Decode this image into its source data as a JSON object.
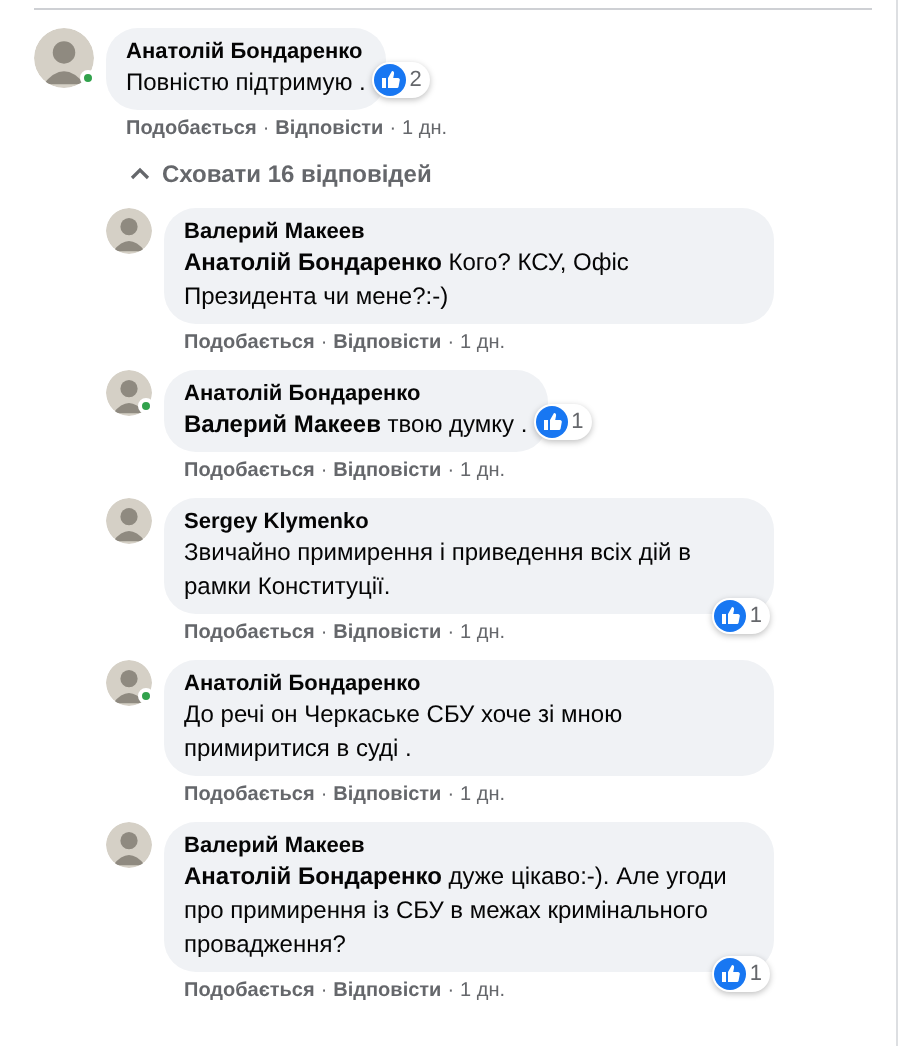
{
  "comments": [
    {
      "author": "Анатолій Бондаренко",
      "online": true,
      "text": "Повністю підтримую .",
      "reaction": {
        "count": "2",
        "kind": "inline"
      },
      "actions": [
        "Подобається",
        "Відповісти",
        "1 дн."
      ],
      "separator": "·",
      "toggle": {
        "label": "Сховати 16 відповідей",
        "expanded": true
      },
      "replies": [
        {
          "author": "Валерий Макеев",
          "online": false,
          "text": "**Анатолій Бондаренко** Кого? КСУ, Офіс Президента чи мене?:-)",
          "actions": [
            "Подобається",
            "Відповісти",
            "1 дн."
          ],
          "separator": "·"
        },
        {
          "author": "Анатолій Бондаренко",
          "online": true,
          "text": "**Валерий Макеев** твою думку .",
          "reaction": {
            "count": "1",
            "kind": "inline"
          },
          "actions": [
            "Подобається",
            "Відповісти",
            "1 дн."
          ],
          "separator": "·"
        },
        {
          "author": "Sergey Klymenko",
          "online": false,
          "text": "Звичайно примирення і приведення всіх дій в рамки Конституції.",
          "reaction": {
            "count": "1",
            "kind": "corner"
          },
          "actions": [
            "Подобається",
            "Відповісти",
            "1 дн."
          ],
          "separator": "·"
        },
        {
          "author": "Анатолій Бондаренко",
          "online": true,
          "text": "До речі он Черкаське СБУ хоче зі мною примиритися в суді .",
          "actions": [
            "Подобається",
            "Відповісти",
            "1 дн."
          ],
          "separator": "·"
        },
        {
          "author": "Валерий Макеев",
          "online": false,
          "text": "**Анатолій Бондаренко** дуже цікаво:-). Але угоди про примирення із СБУ в межах кримінального провадження?",
          "reaction": {
            "count": "1",
            "kind": "corner"
          },
          "actions": [
            "Подобається",
            "Відповісти",
            "1 дн."
          ],
          "separator": "·"
        }
      ]
    }
  ]
}
